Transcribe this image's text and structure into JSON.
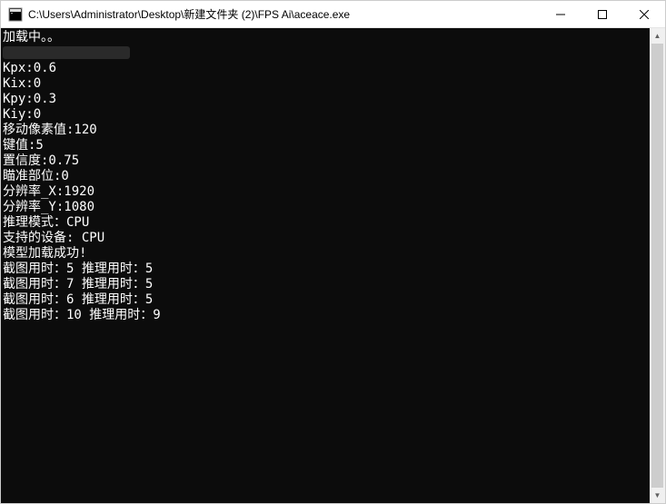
{
  "window": {
    "title": "C:\\Users\\Administrator\\Desktop\\新建文件夹 (2)\\FPS Ai\\aceace.exe"
  },
  "console": {
    "lines": [
      "加载中。。",
      "",
      "Kpx:0.6",
      "Kix:0",
      "Kpy:0.3",
      "Kiy:0",
      "移动像素值:120",
      "键值:5",
      "置信度:0.75",
      "瞄准部位:0",
      "分辨率_X:1920",
      "分辨率_Y:1080",
      "推理模式：CPU",
      "支持的设备: CPU",
      "模型加载成功!",
      "截图用时：5 推理用时：5",
      "截图用时：7 推理用时：5",
      "截图用时：6 推理用时：5",
      "截图用时：10 推理用时：9"
    ],
    "redacted_line_index": 1
  }
}
